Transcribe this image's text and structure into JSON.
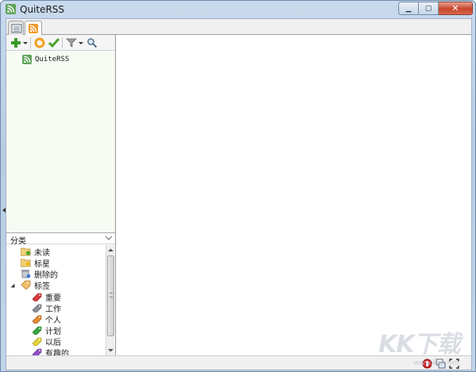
{
  "window": {
    "title": "QuiteRSS"
  },
  "tabs": [
    {
      "icon": "news-list-icon"
    },
    {
      "icon": "rss-feed-icon"
    }
  ],
  "toolbar": {
    "icons": [
      "add-icon",
      "update-icon",
      "mark-read-icon",
      "filter-icon",
      "search-icon"
    ]
  },
  "feeds": [
    {
      "label": "QuiteRSS",
      "icon": "feed-icon"
    }
  ],
  "categories": {
    "header": "分类",
    "items": [
      {
        "label": "未读",
        "icon": "unread-folder-icon"
      },
      {
        "label": "标星",
        "icon": "starred-folder-icon"
      },
      {
        "label": "删除的",
        "icon": "deleted-icon"
      },
      {
        "label": "标签",
        "icon": "labels-icon"
      },
      {
        "label": "重要",
        "icon": "tag-red-icon",
        "color": "#d93a3a"
      },
      {
        "label": "工作",
        "icon": "tag-orange-icon",
        "color": "#e68a2e"
      },
      {
        "label": "个人",
        "icon": "tag-green-icon",
        "color": "#3aa640"
      },
      {
        "label": "计划",
        "icon": "tag-blue-icon",
        "color": "#3d73d6"
      },
      {
        "label": "以后",
        "icon": "tag-yellow-icon",
        "color": "#e6d23a"
      },
      {
        "label": "有趣的",
        "icon": "tag-purple-icon",
        "color": "#8e4ec6"
      }
    ]
  },
  "watermark": {
    "text": "KK下载",
    "sub": "www.kkx.net"
  },
  "colors": {
    "feed_green": "#5fa35a",
    "tree_bg": "#f6fcf4"
  }
}
